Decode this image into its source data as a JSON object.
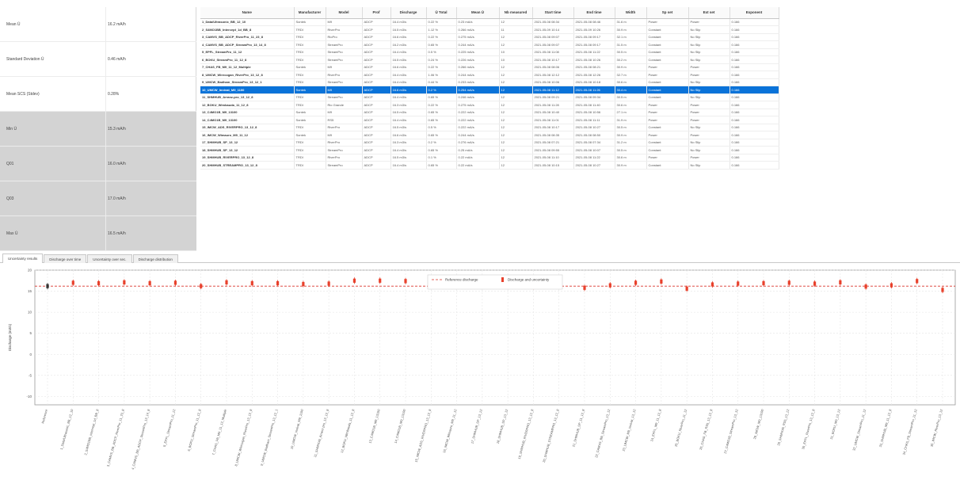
{
  "stats": [
    {
      "label": "Mean Ū",
      "value": "16.2 mA/h",
      "shaded": false
    },
    {
      "label": "Standard Deviation Ū",
      "value": "0.46 mA/h",
      "shaded": false
    },
    {
      "label": "Mean SCS (Stdev)",
      "value": "0.28%",
      "shaded": false
    },
    {
      "label": "Min Ū",
      "value": "15.3 mA/h",
      "shaded": true
    },
    {
      "label": "Q01",
      "value": "16.0 mA/h",
      "shaded": true
    },
    {
      "label": "Q03",
      "value": "17.0 mA/h",
      "shaded": true
    },
    {
      "label": "Max Ū",
      "value": "16.5 mA/h",
      "shaded": true
    }
  ],
  "table": {
    "columns": [
      "Name",
      "Manufacturer",
      "Model",
      "Prof",
      "Discharge",
      "Ū Total",
      "Mean Ū",
      "Nb measured",
      "Start time",
      "End time",
      "Width",
      "Sp set",
      "Ext set",
      "Exponent"
    ],
    "rows": [
      [
        "1_Data/Ultrasonic_BB_12_10",
        "Sontek",
        "M9",
        "ADCP",
        "16.4 m3/s",
        "0.22 %",
        "0.23 mA/s",
        "12",
        "2021-05-08 08:34",
        "2021-05-08 08:46",
        "31.6 m",
        "Power",
        "Power",
        "0.166"
      ],
      [
        "2_S4MO1BB_Intercept_1d_BB_8",
        "TRDI",
        "RiverPro",
        "ADCP",
        "16.5 m3/s",
        "1.12 %",
        "0.266 mA/s",
        "11",
        "2021-05-09 10:14",
        "2021-05-09 10:26",
        "30.9 m",
        "Constant",
        "No Slip",
        "0.166"
      ],
      [
        "3_CAMVS_BB_ADCP_RiverPro_11_23_8",
        "TRDI",
        "RioPro",
        "ADCP",
        "16.6 m3/s",
        "0.22 %",
        "0.275 mA/s",
        "12",
        "2021-05-08 09:07",
        "2021-05-08 09:17",
        "32.1 m",
        "Constant",
        "No Slip",
        "0.166"
      ],
      [
        "4_CAMVS_BB_ADCP_StreamPro_13_14_8",
        "TRDI",
        "StreamPro",
        "ADCP",
        "16.2 m3/s",
        "0.65 %",
        "0.244 mA/s",
        "12",
        "2021-05-08 09:07",
        "2021-05-08 09:17",
        "31.5 m",
        "Constant",
        "No Slip",
        "0.166"
      ],
      [
        "5_EPFL_StreamPro_11_12",
        "TRDI",
        "StreamPro",
        "ADCP",
        "16.4 m3/s",
        "0.5 %",
        "0.225 mA/s",
        "10",
        "2021-05-08 11:08",
        "2021-05-08 11:22",
        "30.5 m",
        "Constant",
        "No Slip",
        "0.166"
      ],
      [
        "6_BOKU_StreamPro_11_12_8",
        "TRDI",
        "StreamPro",
        "ADCP",
        "16.5 m3/s",
        "0.24 %",
        "0.226 mA/s",
        "10",
        "2021-05-08 10:17",
        "2021-05-08 10:26",
        "30.2 m",
        "Constant",
        "No Slip",
        "0.166"
      ],
      [
        "7_CHAS_FB_M9_11_12_Multiple",
        "Sontek",
        "M9",
        "ADCP",
        "16.6 m3/s",
        "0.22 %",
        "0.266 mA/s",
        "12",
        "2021-05-08 08:06",
        "2021-05-08 08:21",
        "30.9 m",
        "Power",
        "Power",
        "0.166"
      ],
      [
        "8_UMCW_Wirecogan_RiverPro_13_12_8",
        "TRDI",
        "RiverPro",
        "ADCP",
        "16.4 m3/s",
        "1.06 %",
        "0.244 mA/s",
        "12",
        "2021-05-08 12:12",
        "2021-05-08 12:26",
        "32.7 m",
        "Power",
        "Power",
        "0.166"
      ],
      [
        "9_UMCW_Badham_StreamPro_13_12_1",
        "TRDI",
        "StreamPro",
        "ADCP",
        "16.4 m3/s",
        "0.44 %",
        "0.233 mA/s",
        "12",
        "2021-05-08 10:06",
        "2021-05-08 10:18",
        "30.6 m",
        "Constant",
        "No Slip",
        "0.166"
      ],
      [
        "10_UMCW_Innivat_M9_1100",
        "Sontek",
        "M9",
        "ADCP",
        "16.6 m3/s",
        "0.2 %",
        "0.254 mA/s",
        "12",
        "2021-05-08 11:12",
        "2021-05-08 11:26",
        "30.4 m",
        "Constant",
        "No Slip",
        "0.166"
      ],
      [
        "11_SHMHUB_Arranz-pro_13_12_8",
        "TRDI",
        "StreamPro",
        "ADCP",
        "16.4 m3/s",
        "0.65 %",
        "0.246 mA/s",
        "12",
        "2021-05-08 09:21",
        "2021-05-08 09:34",
        "30.5 m",
        "Constant",
        "No Slip",
        "0.166"
      ],
      [
        "12_BOKU_Wimbauda_11_12_8",
        "TRDI",
        "Rio Grande",
        "ADCP",
        "16.3 m3/s",
        "0.22 %",
        "0.275 mA/s",
        "12",
        "2021-05-08 11:28",
        "2021-05-08 11:40",
        "30.6 m",
        "Power",
        "Power",
        "0.166"
      ],
      [
        "13_C4MO1B_M9_13100",
        "Sontek",
        "M9",
        "ADCP",
        "16.5 m3/s",
        "0.65 %",
        "0.222 mA/s",
        "12",
        "2021-05-08 10:40",
        "2021-05-08 10:56",
        "27.1 m",
        "Power",
        "Power",
        "0.166"
      ],
      [
        "14_C4MO1B_M9_13100",
        "Sontek",
        "RS5",
        "ADCP",
        "16.4 m3/s",
        "0.65 %",
        "0.222 mA/s",
        "12",
        "2021-05-08 11:01",
        "2021-05-08 11:11",
        "31.9 m",
        "Power",
        "Power",
        "0.166"
      ],
      [
        "15_IMCW_ADS_RIVERPRO_13_12_8",
        "TRDI",
        "RiverPro",
        "ADCP",
        "16.5 m3/s",
        "0.5 %",
        "0.222 mA/s",
        "12",
        "2021-05-08 10:17",
        "2021-05-08 10:27",
        "30.5 m",
        "Constant",
        "No Slip",
        "0.166"
      ],
      [
        "16_IMCW_Wimauro_M9_11_12",
        "Sontek",
        "M9",
        "ADCP",
        "16.6 m3/s",
        "0.65 %",
        "0.244 mA/s",
        "12",
        "2021-05-08 08:35",
        "2021-05-08 08:50",
        "30.9 m",
        "Power",
        "Power",
        "0.166"
      ],
      [
        "17_SHMHUB_SP_13_12",
        "TRDI",
        "RiverPro",
        "ADCP",
        "16.3 m3/s",
        "0.2 %",
        "0.276 mA/s",
        "12",
        "2021-05-08 07:21",
        "2021-05-08 07:34",
        "31.2 m",
        "Constant",
        "No Slip",
        "0.166"
      ],
      [
        "18_SHMHUB_SP_13_12",
        "TRDI",
        "StreamPro",
        "ADCP",
        "16.4 m3/s",
        "0.65 %",
        "0.25 mA/s",
        "12",
        "2021-05-08 09:55",
        "2021-05-08 10:07",
        "30.5 m",
        "Constant",
        "No Slip",
        "0.166"
      ],
      [
        "19_SHMHUB_RIVERPRO_13_12_8",
        "TRDI",
        "RiverPro",
        "ADCP",
        "16.5 m3/s",
        "0.1 %",
        "0.22 mA/s",
        "12",
        "2021-05-08 11:10",
        "2021-05-08 11:22",
        "30.6 m",
        "Power",
        "Power",
        "0.166"
      ],
      [
        "20_SHMHUB_STREAMPRO_13_12_8",
        "TRDI",
        "StreamPro",
        "ADCP",
        "16.4 m3/s",
        "0.65 %",
        "0.22 mA/s",
        "12",
        "2021-05-08 10:15",
        "2021-05-08 10:27",
        "30.9 m",
        "Constant",
        "No Slip",
        "0.166"
      ]
    ],
    "selected_row": 9
  },
  "tabs": [
    {
      "label": "Uncertainty results",
      "active": true
    },
    {
      "label": "Discharge over time",
      "active": false
    },
    {
      "label": "Uncertainty over sec.",
      "active": false
    },
    {
      "label": "Discharge distribution",
      "active": false
    }
  ],
  "chart_data": {
    "type": "scatter",
    "title": "",
    "xlabel": "",
    "ylabel": "Discharge (m3/s)",
    "ylim": [
      -12,
      20
    ],
    "yticks": [
      20,
      15,
      10,
      5,
      0,
      -5,
      -10
    ],
    "grid": true,
    "legend_position": "top-center",
    "legend": [
      "Reference discharge",
      "Discharge and uncertainty"
    ],
    "reference_value": 16.2,
    "categories": [
      "Reference",
      "1_Data/Ultrasonic_BB_12_10",
      "2_S4MO1BB_Intercept_1d_BB_8",
      "3_CAMVS_BB_ADCP_RiverPro_11_23_8",
      "4_CAMVS_BB_ADCP_StreamPro_13_14_8",
      "5_EPFL_StreamPro_11_12",
      "6_BOKU_StreamPro_11_12_8",
      "7_CHAS_FB_M9_11_12_Multiple",
      "8_UMCW_Wirecogan_RiverPro_13_12_8",
      "9_UMCW_Badham_StreamPro_13_12_1",
      "10_UMCW_Innivat_M9_1100",
      "11_SHMHUB_Arranz-pro_13_12_8",
      "12_BOKU_Wimbauda_11_12_8",
      "13_C4MO1B_M9_13100",
      "14_C4MO1B_M9_13100",
      "15_IMCW_ADS_RIVERPRO_13_12_8",
      "16_IMCW_Wimauro_M9_11_12",
      "17_SHMHUB_SP_13_12",
      "18_SHMHUB_SP_13_12",
      "19_SHMHUB_RIVERPRO_13_12_8",
      "20_SHMHUB_STREAMPRO_13_12_8",
      "21_SHMHUB_SP_11_12_8",
      "22_CAMVS_BB_StreamPro_13_12",
      "23_UMCW_M9_Innivat_13_12",
      "24_EPFL_M9_11_12_8",
      "25_BOKU_RiverPro_11_12",
      "26_CHAS_FB_RS5_13_12_8",
      "27_C4MO1B_StreamPro_13_12",
      "28_IMCW_M9_13100",
      "29_SHMHUB_RS5_13_12",
      "30_EPFL_RiverPro_13_12_8",
      "31_BOKU_M9_13_12",
      "32_UMCW_StreamPro_11_12",
      "33_SHMHUB_M9_11_12_8",
      "34_CHAS_FB_StreamPro_11_12",
      "35_IMCW_RiverPro_13_12"
    ],
    "series": [
      {
        "values": [
          16.2,
          17.0,
          16.9,
          17.1,
          16.9,
          17.0,
          16.2,
          17.1,
          16.9,
          16.9,
          16.7,
          16.8,
          17.5,
          17.5,
          17.4,
          16.6,
          17.2,
          16.3,
          16.6,
          16.2,
          16.6,
          15.8,
          16.4,
          17.0,
          17.3,
          15.6,
          16.6,
          16.8,
          16.9,
          17.0,
          16.8,
          17.1,
          16.1,
          16.4,
          17.4,
          15.3
        ]
      },
      {
        "name": "Reference discharge",
        "values": [
          16.2
        ]
      }
    ]
  },
  "colors": {
    "selection": "#0a73d9",
    "marker": "#e8412c",
    "reference_line": "#d9342b",
    "shaded_stat": "#d3d3d3"
  }
}
